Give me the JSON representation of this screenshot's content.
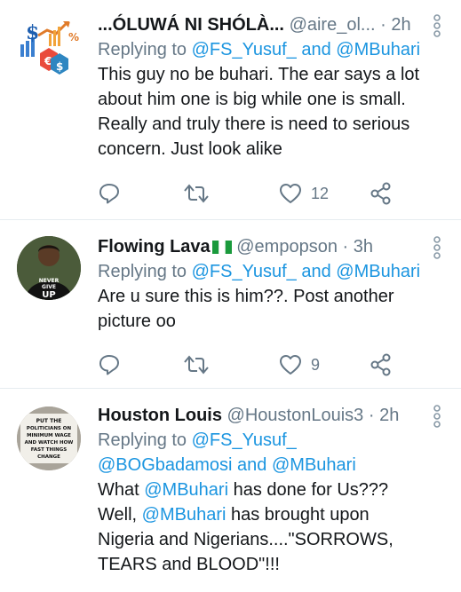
{
  "tweets": [
    {
      "name": "...ÓLUWÁ NI SHÓLÀ...",
      "handle": "@aire_ol...",
      "time": "2h",
      "reply_prefix": "Replying to",
      "reply_to_1": "@FS_Yusuf_",
      "reply_and": "and",
      "reply_to_2": "@MBuhari",
      "lines": [
        "This guy no be buhari. The ear says a lot",
        "about him one is big while one is small.",
        "Really and truly there is need to serious",
        "concern. Just look alike"
      ],
      "like_count": "12"
    },
    {
      "name": "Flowing Lava",
      "handle": "@empopson",
      "time": "3h",
      "reply_prefix": "Replying to",
      "reply_to_1": "@FS_Yusuf_",
      "reply_and": "and",
      "reply_to_2": "@MBuhari",
      "lines": [
        "Are u sure this is him??. Post another",
        "picture oo"
      ],
      "like_count": "9",
      "avatar_text": [
        "NEVER",
        "GIVE",
        "UP"
      ]
    },
    {
      "name": "Houston Louis",
      "handle": "@HoustonLouis3",
      "time": "2h",
      "reply_prefix": "Replying to",
      "reply_to_1": "@FS_Yusuf_",
      "reply_to_2": "@BOGbadamosi",
      "reply_and": "and",
      "reply_to_3": "@MBuhari",
      "line1_prefix": "What",
      "line1_mention": "@MBuhari",
      "line1_suffix": "has done for Us???",
      "line2_prefix": "Well,",
      "line2_mention": "@MBuhari",
      "line2_suffix": "has brought upon",
      "line3": "Nigeria and Nigerians....\"SORROWS,",
      "line4": "TEARS and BLOOD\"!!!",
      "avatar_text": [
        "PUT THE",
        "POLITICIANS ON",
        "MINIMUM WAGE",
        "AND WATCH HOW",
        "FAST THINGS",
        "CHANGE"
      ]
    }
  ],
  "colors": {
    "link": "#1b95e0",
    "muted": "#657786",
    "text": "#14171a",
    "divider": "#e6ecf0"
  }
}
